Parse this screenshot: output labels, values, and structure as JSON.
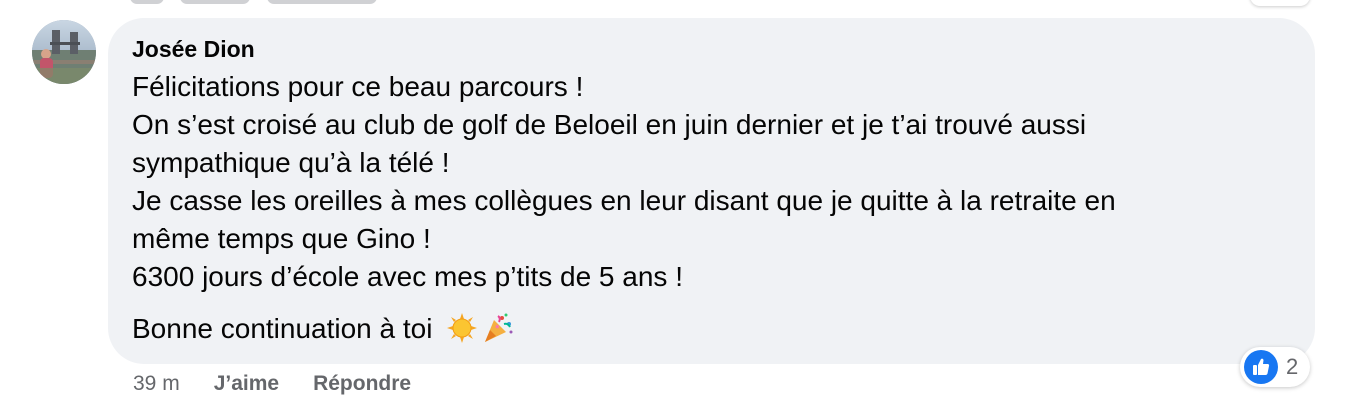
{
  "comment": {
    "author": "Josée Dion",
    "lines": [
      "Félicitations pour ce beau parcours !",
      "On s’est croisé au club de golf de Beloeil en juin dernier et je t’ai trouvé aussi",
      "sympathique qu’à la télé !",
      "Je casse les oreilles à mes collègues en leur disant que je quitte à la retraite en",
      "même temps que Gino !",
      "6300 jours d’école avec mes p’tits de 5 ans !"
    ],
    "closing": "Bonne continuation à toi",
    "closing_emojis": [
      "sun-emoji",
      "party-popper-emoji"
    ]
  },
  "reaction": {
    "icon": "thumbs-up-icon",
    "count": "2",
    "color": "#1877f2"
  },
  "actions": {
    "time": "39 m",
    "like_label": "J’aime",
    "reply_label": "Répondre"
  },
  "colors": {
    "bubble": "#f0f2f5",
    "meta_text": "#65676b",
    "text": "#050505"
  }
}
